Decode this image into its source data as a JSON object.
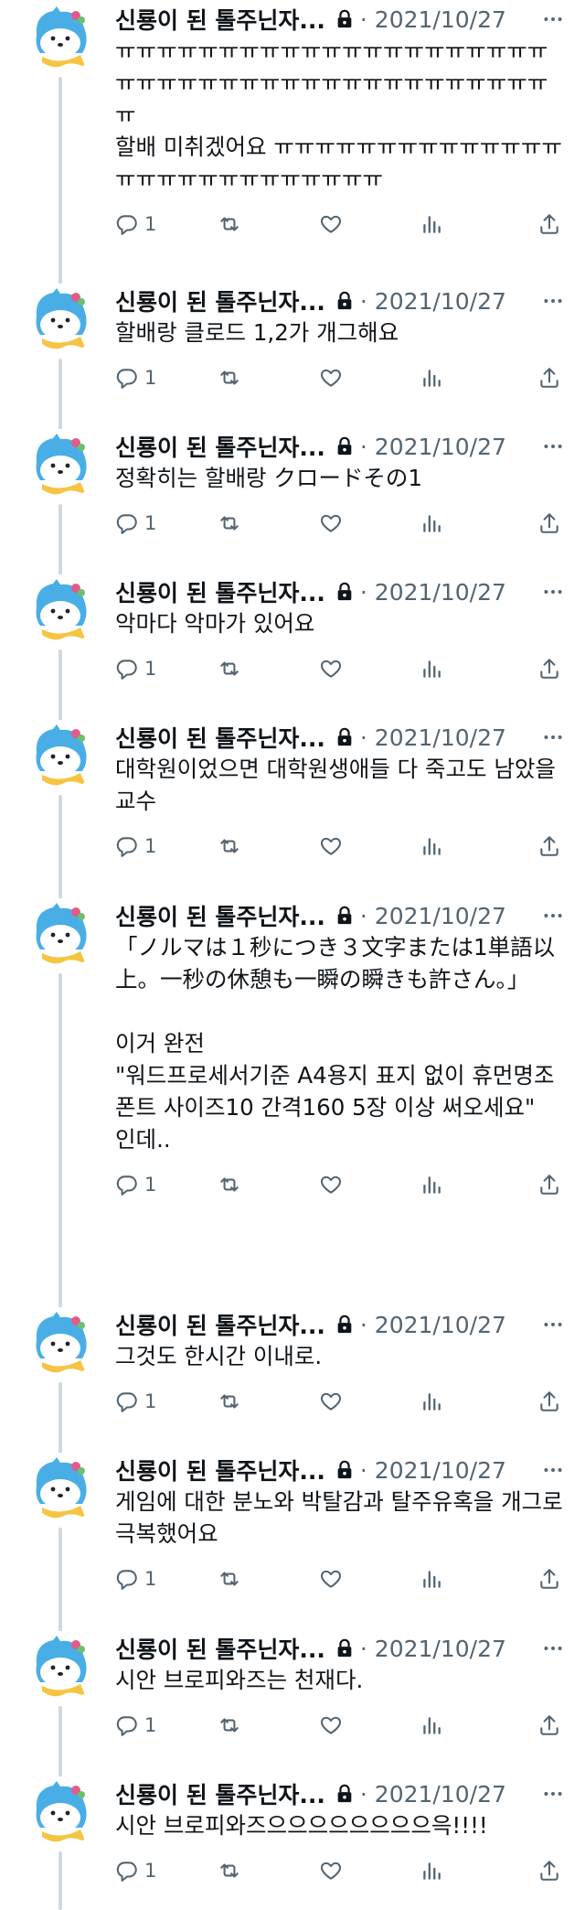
{
  "colors": {
    "line": "#cfd9de",
    "muted": "#536471",
    "text": "#0f1419",
    "avatar_blue": "#4aaee6",
    "scarf": "#f5c542"
  },
  "tweets": [
    {
      "name": "신룡이 된 톨주닌자...",
      "date": "· 2021/10/27",
      "text": "ㅠㅠㅠㅠㅠㅠㅠㅠㅠㅠㅠㅠㅠㅠㅠㅠㅠㅠㅠㅠㅠㅠㅠㅠㅠㅠㅠㅠㅠㅠㅠㅠㅠㅠㅠㅠㅠㅠㅠㅠㅠㅠㅠ\n할배 미취겠어요 ㅠㅠㅠㅠㅠㅠㅠㅠㅠㅠㅠㅠㅠㅠㅠㅠㅠㅠㅠㅠㅠㅠㅠㅠㅠㅠㅠ",
      "replies": "1"
    },
    {
      "name": "신룡이 된 톨주닌자...",
      "date": "· 2021/10/27",
      "text": "할배랑 클로드 1,2가 개그해요",
      "replies": "1"
    },
    {
      "name": "신룡이 된 톨주닌자...",
      "date": "· 2021/10/27",
      "text": "정확히는 할배랑 クロードその1",
      "replies": "1"
    },
    {
      "name": "신룡이 된 톨주닌자...",
      "date": "· 2021/10/27",
      "text": "악마다 악마가 있어요",
      "replies": "1"
    },
    {
      "name": "신룡이 된 톨주닌자...",
      "date": "· 2021/10/27",
      "text": "대학원이었으면 대학원생애들 다 죽고도 남았을 교수",
      "replies": "1"
    },
    {
      "name": "신룡이 된 톨주닌자...",
      "date": "· 2021/10/27",
      "text": "「ノルマは１秒につき３文字または1単語以上。一秒の休憩も一瞬の瞬きも許さん。」\n\n이거 완전\n\"워드프로세서기준 A4용지 표지 없이 휴먼명조 폰트 사이즈10 간격160 5장 이상 써오세요\"\n인데..",
      "replies": "1"
    },
    {
      "name": "신룡이 된 톨주닌자...",
      "date": "· 2021/10/27",
      "text": "그것도 한시간 이내로.",
      "replies": "1"
    },
    {
      "name": "신룡이 된 톨주닌자...",
      "date": "· 2021/10/27",
      "text": "게임에 대한 분노와 박탈감과 탈주유혹을 개그로 극복했어요",
      "replies": "1"
    },
    {
      "name": "신룡이 된 톨주닌자...",
      "date": "· 2021/10/27",
      "text": "시안 브로피와즈는 천재다.",
      "replies": "1"
    },
    {
      "name": "신룡이 된 톨주닌자...",
      "date": "· 2021/10/27",
      "text": "시안 브로피와즈으으으으으으으으윽!!!!",
      "replies": "1"
    }
  ]
}
